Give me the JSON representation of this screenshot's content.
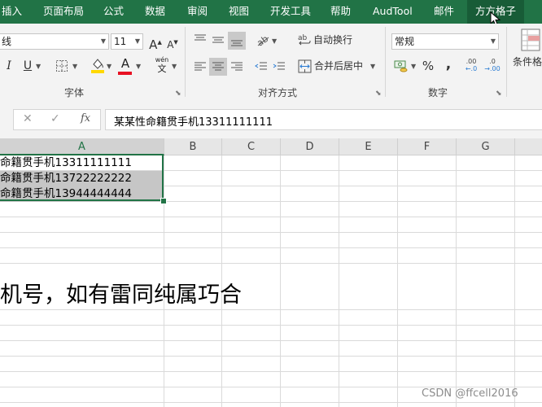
{
  "menu": {
    "tabs": [
      "插入",
      "页面布局",
      "公式",
      "数据",
      "审阅",
      "视图",
      "开发工具",
      "帮助",
      "AudTool",
      "邮件",
      "方方格子"
    ],
    "active_tab": "方方格子"
  },
  "ribbon": {
    "font_group": {
      "font_name": "线",
      "font_size": "11",
      "grow_label": "A",
      "shrink_label": "A",
      "italic_label": "I",
      "underline_label": "U",
      "font_color_label": "A",
      "phonetic_top": "wén",
      "phonetic_bottom": "文",
      "label": "字体"
    },
    "alignment_group": {
      "wrap_text": "自动换行",
      "merge_center": "合并后居中",
      "label": "对齐方式"
    },
    "number_group": {
      "format": "常规",
      "percent": "%",
      "comma": ",",
      "dec_increase": ".00",
      "dec_decrease": ".0",
      "label": "数字"
    },
    "styles_group": {
      "conditional_format": "条件格"
    },
    "colors": {
      "font_color_bar": "#e81123",
      "fill_color_bar": "#ffd800",
      "accent": "#217346"
    }
  },
  "formula_bar": {
    "cancel": "✕",
    "confirm": "✓",
    "fx": "fx",
    "content": "某某性命籍贯手机13311111111"
  },
  "grid": {
    "columns": [
      "A",
      "B",
      "C",
      "D",
      "E",
      "F",
      "G"
    ],
    "cells": [
      "命籍贯手机13311111111",
      "命籍贯手机13722222222",
      "命籍贯手机13944444444"
    ],
    "big_text": "机号，如有雷同纯属巧合"
  },
  "watermark": "CSDN @ffcell2016"
}
